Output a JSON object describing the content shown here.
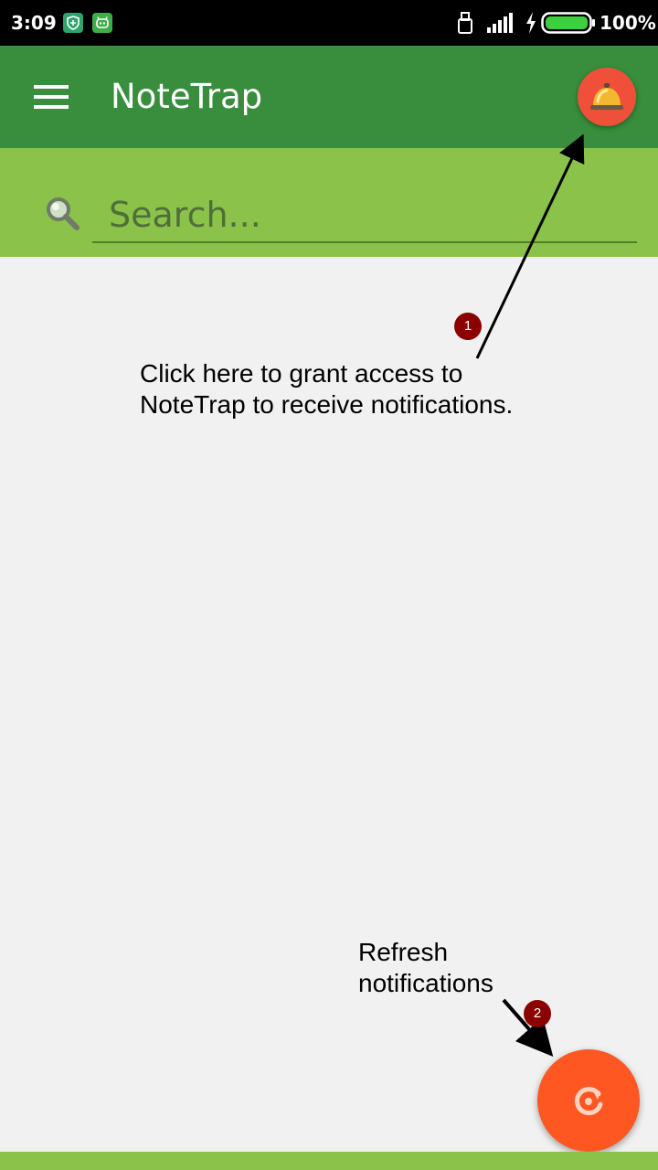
{
  "status_bar": {
    "time": "3:09",
    "battery_percent": "100%",
    "battery_level": 1.0,
    "icons": [
      "shield-icon",
      "robot-icon",
      "sim-icon",
      "signal-icon",
      "charging-icon",
      "battery-icon"
    ]
  },
  "toolbar": {
    "title": "NoteTrap",
    "menu_icon": "hamburger-menu-icon",
    "action_icon": "bell-icon"
  },
  "search": {
    "placeholder": "Search...",
    "value": ""
  },
  "annotations": {
    "step1_number": "1",
    "step1_text": "Click here to grant access to NoteTrap to receive notifications.",
    "step2_number": "2",
    "step2_text": "Refresh notifications"
  },
  "fab": {
    "icon": "refresh-icon"
  },
  "colors": {
    "status_bar": "#000000",
    "toolbar": "#388e3c",
    "search_area": "#8bc34a",
    "content_bg": "#f1f1f1",
    "bell_button": "#f0503a",
    "fab": "#fe5722",
    "badge": "#8b0000"
  }
}
